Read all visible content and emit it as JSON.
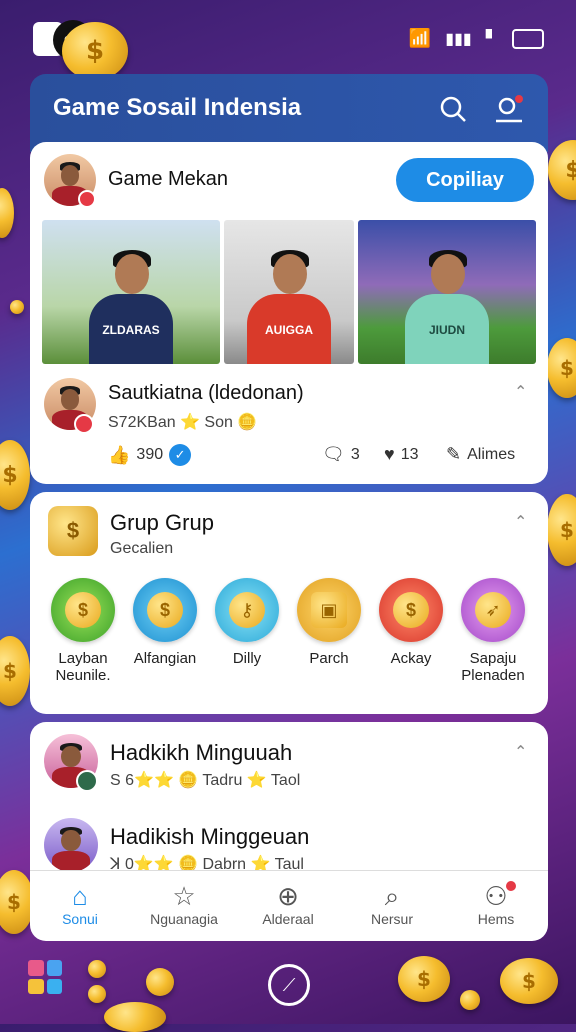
{
  "colors": {
    "header": "#2a4f9c",
    "accent": "#1e8ce6",
    "badge_red": "#e53945"
  },
  "header": {
    "title": "Game Sosail Indensia",
    "search_icon": "search-icon",
    "profile_icon": "profile-notification-icon"
  },
  "post": {
    "author": "Game Mekan",
    "action_button": "Copiliay",
    "photos": [
      {
        "shirt_text": "ZLDARAS"
      },
      {
        "shirt_text": "AUIGGA"
      },
      {
        "shirt_text": "JIUDN"
      }
    ],
    "commenter": {
      "name": "Sautkiatna (ldedonan)",
      "meta": "S72KBan ⭐ Son 🪙"
    },
    "stats": {
      "likes": "390",
      "comments": "3",
      "hearts": "13",
      "share_label": "Alimes"
    }
  },
  "group": {
    "title": "Grup Grup",
    "subtitle": "Gecalien",
    "items": [
      {
        "label": "Layban",
        "sub": "Neunile."
      },
      {
        "label": "Alfangian",
        "sub": ""
      },
      {
        "label": "Dilly",
        "sub": ""
      },
      {
        "label": "Parch",
        "sub": ""
      },
      {
        "label": "Ackay",
        "sub": ""
      },
      {
        "label": "Sapaju",
        "sub": "Plenaden"
      }
    ]
  },
  "weekly": [
    {
      "title": "Hadkikh Minguuah",
      "meta": "S 6⭐⭐ 🪙 Tadru ⭐ Taol"
    },
    {
      "title": "Hadikish Minggeuan",
      "meta": "ꓘ 0⭐⭐ 🪙 Dabrn ⭐ Taul"
    }
  ],
  "nav": [
    {
      "label": "Sonui",
      "icon": "home-icon"
    },
    {
      "label": "Nguanagia",
      "icon": "star-icon"
    },
    {
      "label": "Alderaal",
      "icon": "upload-icon"
    },
    {
      "label": "Nersur",
      "icon": "search-icon"
    },
    {
      "label": "Hems",
      "icon": "profile-icon"
    }
  ]
}
